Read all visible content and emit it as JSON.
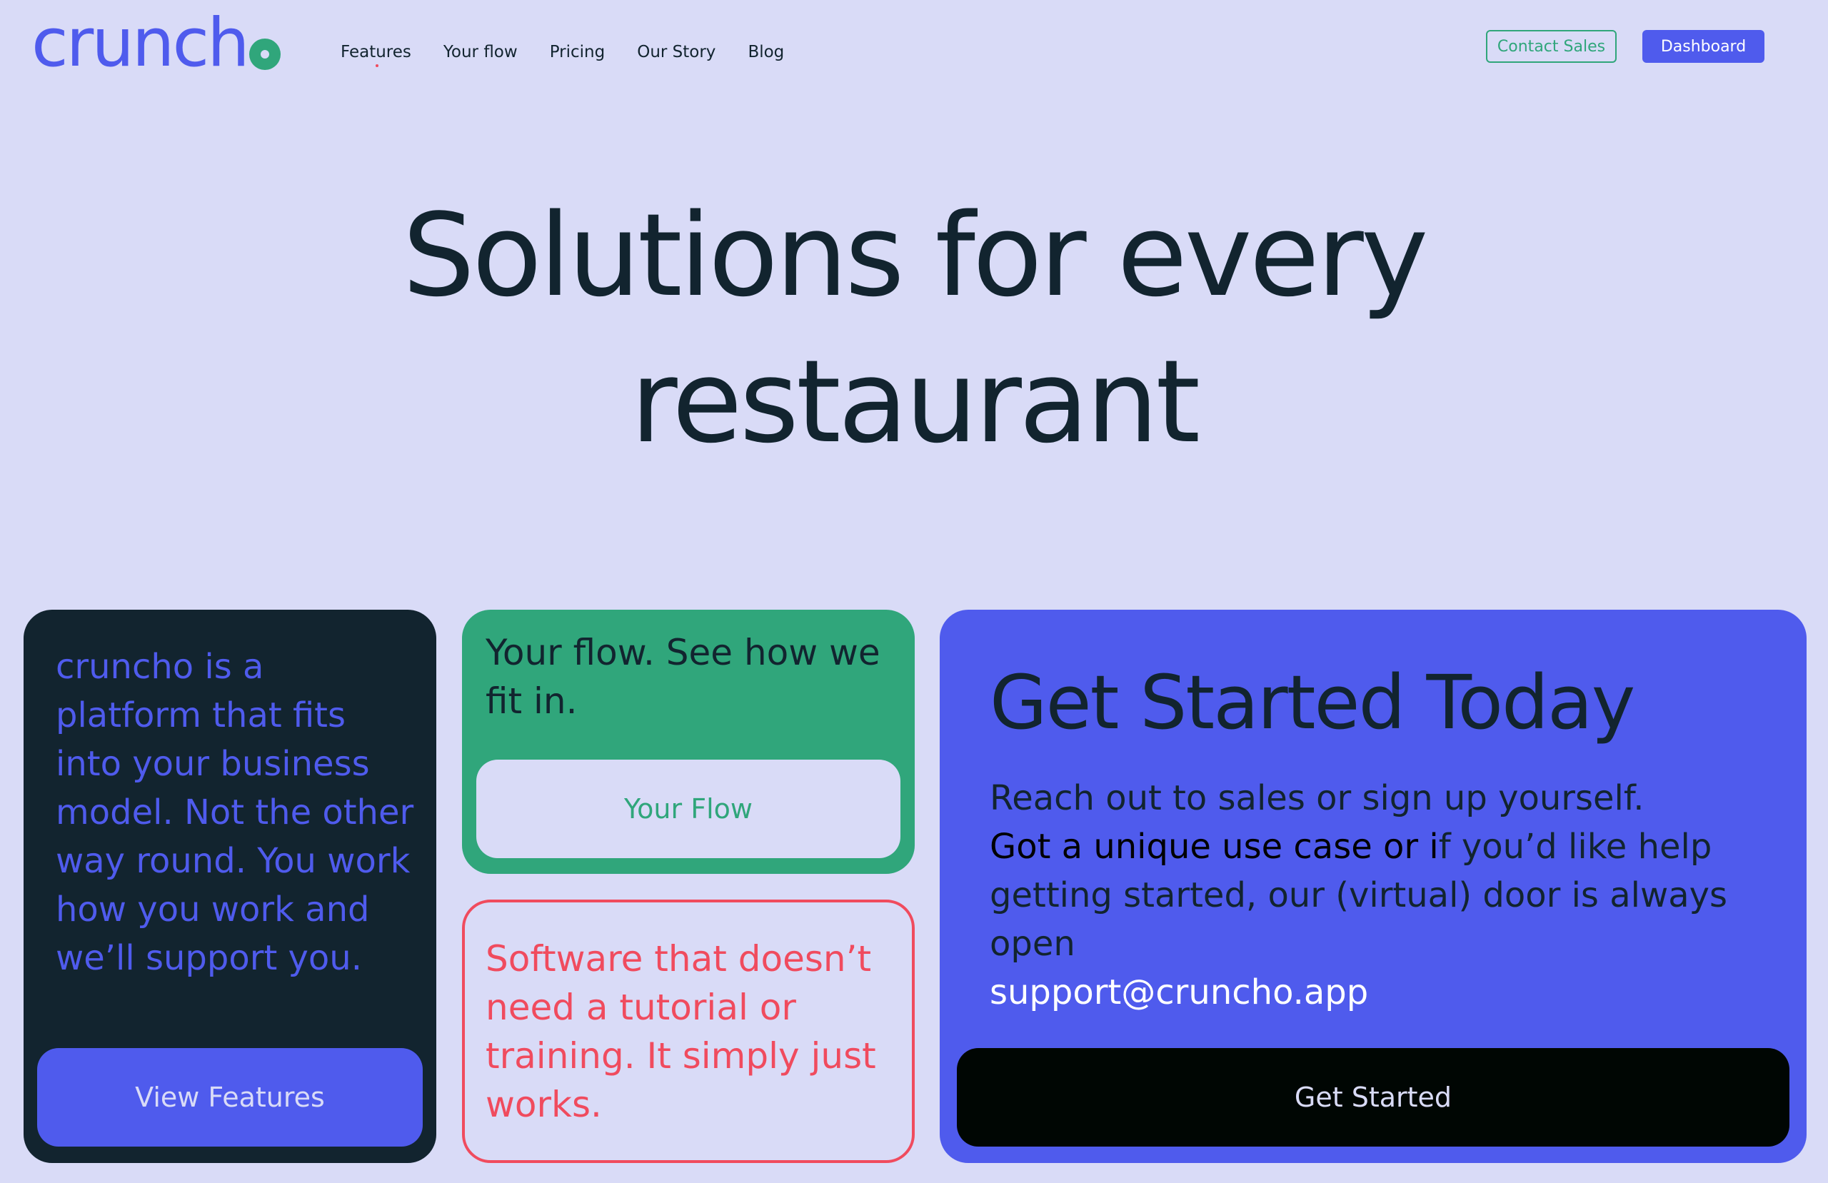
{
  "header": {
    "logo_text": "crunch",
    "nav": [
      {
        "label": "Features"
      },
      {
        "label": "Your flow"
      },
      {
        "label": "Pricing"
      },
      {
        "label": "Our Story"
      },
      {
        "label": "Blog"
      }
    ],
    "contact_label": "Contact Sales",
    "dashboard_label": "Dashboard"
  },
  "hero": {
    "line1": "Solutions for every",
    "line2": "restaurant"
  },
  "cards": {
    "platform": {
      "text": "cruncho is a platform that fits into your business model. Not the other way round. You work how you work and we’ll support you.",
      "button": "View Features"
    },
    "flow": {
      "text": "Your flow. See how we fit in.",
      "button": "Your Flow"
    },
    "software": {
      "text": "Software that doesn’t need a tutorial or training. It simply just works."
    },
    "get_started": {
      "title": "Get Started Today",
      "line1": "Reach out to sales or sign up yourself.",
      "strong": "Got a unique use case or i",
      "line2_rest": "f you’d like help getting started, our (virtual) door is always open",
      "email": "support@cruncho.app",
      "button": "Get Started"
    }
  },
  "colors": {
    "background": "#d9dbf7",
    "brand_blue": "#4f5bed",
    "brand_green": "#30a67b",
    "brand_red": "#f04b5e",
    "dark": "#12242f"
  }
}
